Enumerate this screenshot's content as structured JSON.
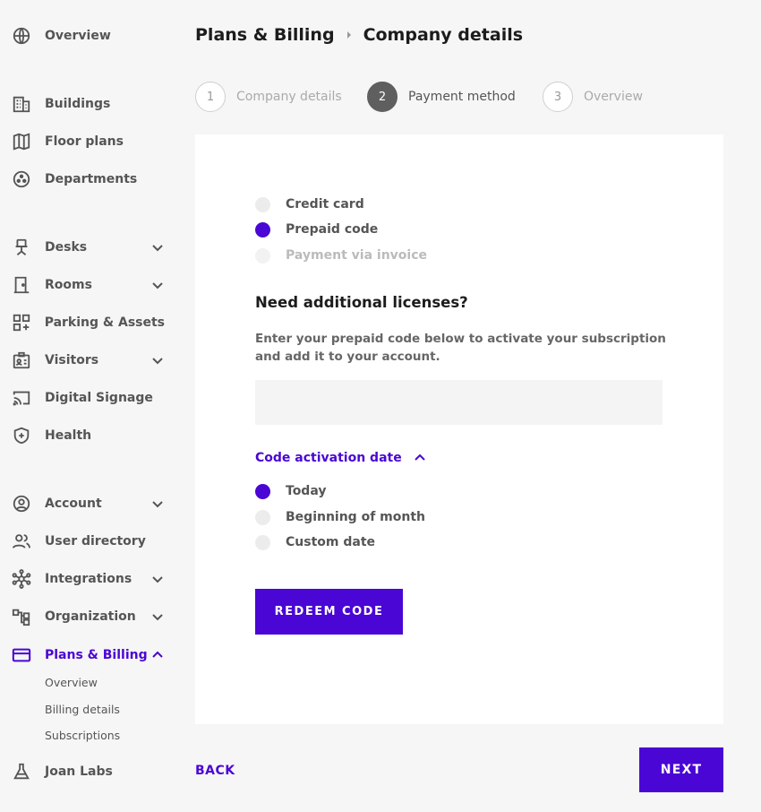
{
  "sidebar": {
    "items": [
      {
        "label": "Overview",
        "icon": "globe-icon"
      },
      {
        "label": "Buildings",
        "icon": "building-icon"
      },
      {
        "label": "Floor plans",
        "icon": "map-icon"
      },
      {
        "label": "Departments",
        "icon": "departments-icon"
      },
      {
        "label": "Desks",
        "icon": "desk-chair-icon"
      },
      {
        "label": "Rooms",
        "icon": "door-icon"
      },
      {
        "label": "Parking & Assets",
        "icon": "grid-plus-icon"
      },
      {
        "label": "Visitors",
        "icon": "visitor-badge-icon"
      },
      {
        "label": "Digital Signage",
        "icon": "cast-icon"
      },
      {
        "label": "Health",
        "icon": "shield-plus-icon"
      },
      {
        "label": "Account",
        "icon": "account-icon"
      },
      {
        "label": "User directory",
        "icon": "users-icon"
      },
      {
        "label": "Integrations",
        "icon": "hub-icon"
      },
      {
        "label": "Organization",
        "icon": "org-chart-icon"
      },
      {
        "label": "Plans & Billing",
        "icon": "credit-card-icon"
      },
      {
        "label": "Joan Labs",
        "icon": "flask-icon"
      }
    ],
    "billing_sub": [
      "Overview",
      "Billing details",
      "Subscriptions"
    ]
  },
  "header": {
    "crumb_parent": "Plans & Billing",
    "crumb_current": "Company details"
  },
  "stepper": [
    {
      "num": "1",
      "label": "Company details"
    },
    {
      "num": "2",
      "label": "Payment method"
    },
    {
      "num": "3",
      "label": "Overview"
    }
  ],
  "payment_methods": [
    "Credit card",
    "Prepaid code",
    "Payment via invoice"
  ],
  "main": {
    "section_title": "Need additional licenses?",
    "description": "Enter your prepaid code below to activate your subscription and add it to your account.",
    "code_value": "",
    "activation_toggle": "Code activation date",
    "activation_options": [
      "Today",
      "Beginning of month",
      "Custom date"
    ],
    "redeem_label": "REDEEM CODE"
  },
  "footer": {
    "back_label": "BACK",
    "next_label": "NEXT"
  },
  "colors": {
    "accent": "#4a06d4",
    "step_current": "#5f5f5f",
    "background": "#f6f6f6"
  }
}
